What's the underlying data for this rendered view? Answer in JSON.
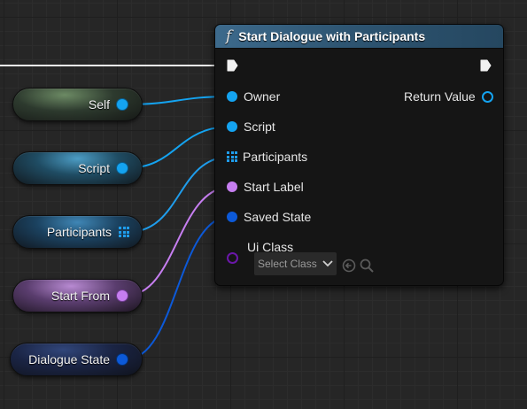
{
  "function_node": {
    "title": "Start Dialogue with Participants",
    "icon": "function-icon",
    "header_color": "#3d6a8c",
    "inputs": [
      {
        "label": "Owner",
        "type": "object",
        "color": "#14a3f0"
      },
      {
        "label": "Script",
        "type": "object",
        "color": "#14a3f0"
      },
      {
        "label": "Participants",
        "type": "array",
        "color": "#1f9dec"
      },
      {
        "label": "Start Label",
        "type": "name",
        "color": "#c67ef0"
      },
      {
        "label": "Saved State",
        "type": "struct",
        "color": "#0c59d8"
      },
      {
        "label": "Ui Class",
        "type": "class",
        "color": "#6a17a8"
      }
    ],
    "outputs": [
      {
        "label": "Return Value",
        "type": "object",
        "color": "#14a3f0"
      }
    ],
    "ui_class_select": {
      "value": "Select Class"
    }
  },
  "variables": [
    {
      "label": "Self",
      "pin": "dot",
      "color": "#14a3f0"
    },
    {
      "label": "Script",
      "pin": "dot",
      "color": "#14a3f0"
    },
    {
      "label": "Participants",
      "pin": "grid",
      "color": "#1f9dec"
    },
    {
      "label": "Start From",
      "pin": "dot",
      "color": "#c67ef0"
    },
    {
      "label": "Dialogue State",
      "pin": "dot",
      "color": "#0c59d8"
    }
  ]
}
